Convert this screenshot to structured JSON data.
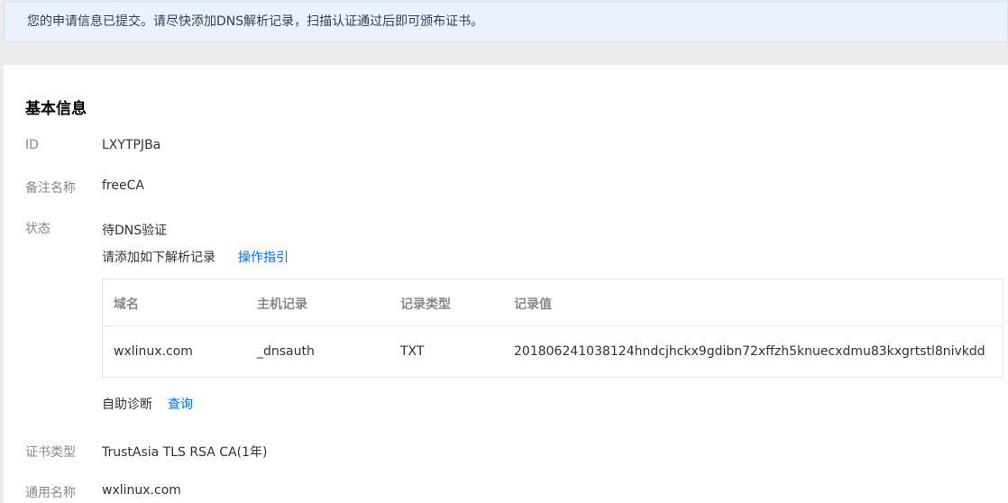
{
  "notice": {
    "text": "您的申请信息已提交。请尽快添加DNS解析记录，扫描认证通过后即可颁布证书。"
  },
  "section": {
    "title": "基本信息"
  },
  "fields": {
    "id": {
      "label": "ID",
      "value": "LXYTPJBa"
    },
    "remark": {
      "label": "备注名称",
      "value": "freeCA"
    },
    "status": {
      "label": "状态",
      "value": "待DNS验证",
      "hint": "请添加如下解析记录",
      "guide_link": "操作指引"
    },
    "cert_type": {
      "label": "证书类型",
      "value": "TrustAsia TLS RSA CA(1年)"
    },
    "common_name": {
      "label": "通用名称",
      "value": "wxlinux.com"
    }
  },
  "dns_table": {
    "headers": [
      "域名",
      "主机记录",
      "记录类型",
      "记录值"
    ],
    "rows": [
      [
        "wxlinux.com",
        "_dnsauth",
        "TXT",
        "201806241038124hndcjhckx9gdibn72xffzh5knuecxdmu83kxgrtstl8nivkdd"
      ]
    ]
  },
  "diagnose": {
    "label": "自助诊断",
    "link": "查询"
  },
  "colors": {
    "link": "#006eff",
    "notice_bg": "#eaf3fd"
  }
}
